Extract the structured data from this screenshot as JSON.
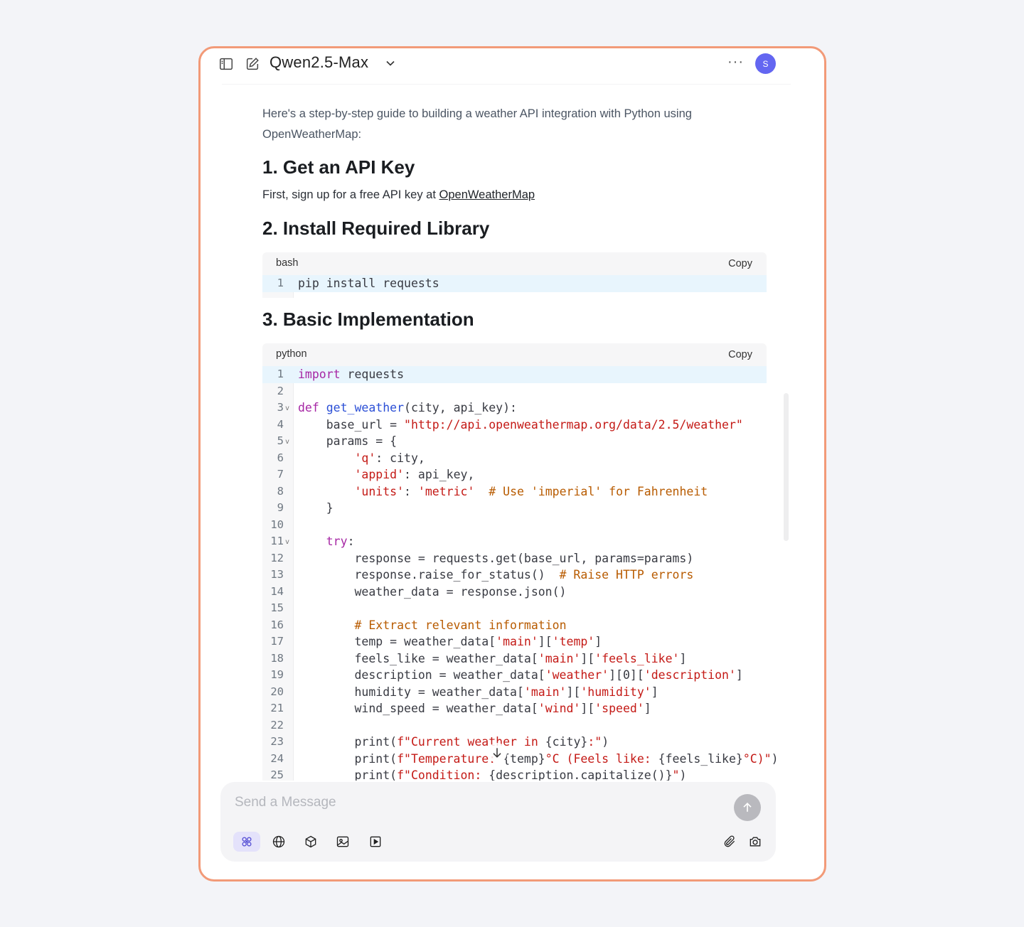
{
  "header": {
    "model_name": "Qwen2.5-Max",
    "avatar_initial": "S",
    "more_label": "···"
  },
  "message": {
    "intro": "Here's a step-by-step guide to building a weather API integration with Python using OpenWeatherMap:",
    "h1": "1. Get an API Key",
    "p1_prefix": "First, sign up for a free API key at ",
    "p1_link": "OpenWeatherMap",
    "h2": "2. Install Required Library",
    "h3": "3. Basic Implementation"
  },
  "code_blocks": [
    {
      "language": "bash",
      "copy_label": "Copy",
      "lines": [
        [
          {
            "t": "pip install requests"
          }
        ]
      ]
    },
    {
      "language": "python",
      "copy_label": "Copy",
      "lines": [
        [
          {
            "t": "import",
            "c": "kw"
          },
          {
            "t": " requests"
          }
        ],
        [],
        [
          {
            "t": "def",
            "c": "kw"
          },
          {
            "t": " "
          },
          {
            "t": "get_weather",
            "c": "fn"
          },
          {
            "t": "(city, api_key):"
          }
        ],
        [
          {
            "t": "    base_url = "
          },
          {
            "t": "\"http://api.openweathermap.org/data/2.5/weather\"",
            "c": "str"
          }
        ],
        [
          {
            "t": "    params = {"
          }
        ],
        [
          {
            "t": "        "
          },
          {
            "t": "'q'",
            "c": "str"
          },
          {
            "t": ": city,"
          }
        ],
        [
          {
            "t": "        "
          },
          {
            "t": "'appid'",
            "c": "str"
          },
          {
            "t": ": api_key,"
          }
        ],
        [
          {
            "t": "        "
          },
          {
            "t": "'units'",
            "c": "str"
          },
          {
            "t": ": "
          },
          {
            "t": "'metric'",
            "c": "str"
          },
          {
            "t": "  "
          },
          {
            "t": "# Use 'imperial' for Fahrenheit",
            "c": "cm"
          }
        ],
        [
          {
            "t": "    }"
          }
        ],
        [],
        [
          {
            "t": "    "
          },
          {
            "t": "try",
            "c": "kw"
          },
          {
            "t": ":"
          }
        ],
        [
          {
            "t": "        response = requests.get(base_url, params=params)"
          }
        ],
        [
          {
            "t": "        response.raise_for_status()  "
          },
          {
            "t": "# Raise HTTP errors",
            "c": "cm"
          }
        ],
        [
          {
            "t": "        weather_data = response.json()"
          }
        ],
        [],
        [
          {
            "t": "        "
          },
          {
            "t": "# Extract relevant information",
            "c": "cm"
          }
        ],
        [
          {
            "t": "        temp = weather_data["
          },
          {
            "t": "'main'",
            "c": "str"
          },
          {
            "t": "]["
          },
          {
            "t": "'temp'",
            "c": "str"
          },
          {
            "t": "]"
          }
        ],
        [
          {
            "t": "        feels_like = weather_data["
          },
          {
            "t": "'main'",
            "c": "str"
          },
          {
            "t": "]["
          },
          {
            "t": "'feels_like'",
            "c": "str"
          },
          {
            "t": "]"
          }
        ],
        [
          {
            "t": "        description = weather_data["
          },
          {
            "t": "'weather'",
            "c": "str"
          },
          {
            "t": "][0]["
          },
          {
            "t": "'description'",
            "c": "str"
          },
          {
            "t": "]"
          }
        ],
        [
          {
            "t": "        humidity = weather_data["
          },
          {
            "t": "'main'",
            "c": "str"
          },
          {
            "t": "]["
          },
          {
            "t": "'humidity'",
            "c": "str"
          },
          {
            "t": "]"
          }
        ],
        [
          {
            "t": "        wind_speed = weather_data["
          },
          {
            "t": "'wind'",
            "c": "str"
          },
          {
            "t": "]["
          },
          {
            "t": "'speed'",
            "c": "str"
          },
          {
            "t": "]"
          }
        ],
        [],
        [
          {
            "t": "        print("
          },
          {
            "t": "f\"Current weather in ",
            "c": "str"
          },
          {
            "t": "{city}"
          },
          {
            "t": ":\"",
            "c": "str"
          },
          {
            "t": ")"
          }
        ],
        [
          {
            "t": "        print("
          },
          {
            "t": "f\"Temperature: ",
            "c": "str"
          },
          {
            "t": "{temp}"
          },
          {
            "t": "°C (Feels like: ",
            "c": "str"
          },
          {
            "t": "{feels_like}"
          },
          {
            "t": "°C)\"",
            "c": "str"
          },
          {
            "t": ")"
          }
        ],
        [
          {
            "t": "        print("
          },
          {
            "t": "f\"Condition: ",
            "c": "str"
          },
          {
            "t": "{description.capitalize()}"
          },
          {
            "t": "\"",
            "c": "str"
          },
          {
            "t": ")"
          }
        ]
      ],
      "foldable_lines": [
        3,
        5,
        11
      ]
    }
  ],
  "composer": {
    "placeholder": "Send a Message"
  },
  "icons": {
    "sidebar_toggle": "sidebar-toggle-icon",
    "new_chat": "edit-icon",
    "dropdown": "chevron-down-icon",
    "scroll_down": "arrow-down-icon",
    "send": "arrow-up-icon",
    "tools": [
      "sparkle-icon",
      "globe-icon",
      "cube-icon",
      "image-icon",
      "video-icon"
    ],
    "right_tools": [
      "paperclip-icon",
      "camera-icon"
    ]
  },
  "colors": {
    "frame_border": "#f29a78",
    "avatar": "#6366f1",
    "keyword": "#a626a4",
    "function": "#2b4fd6",
    "string": "#c41a16",
    "comment": "#b85b00",
    "active_line": "#e8f5fd"
  }
}
